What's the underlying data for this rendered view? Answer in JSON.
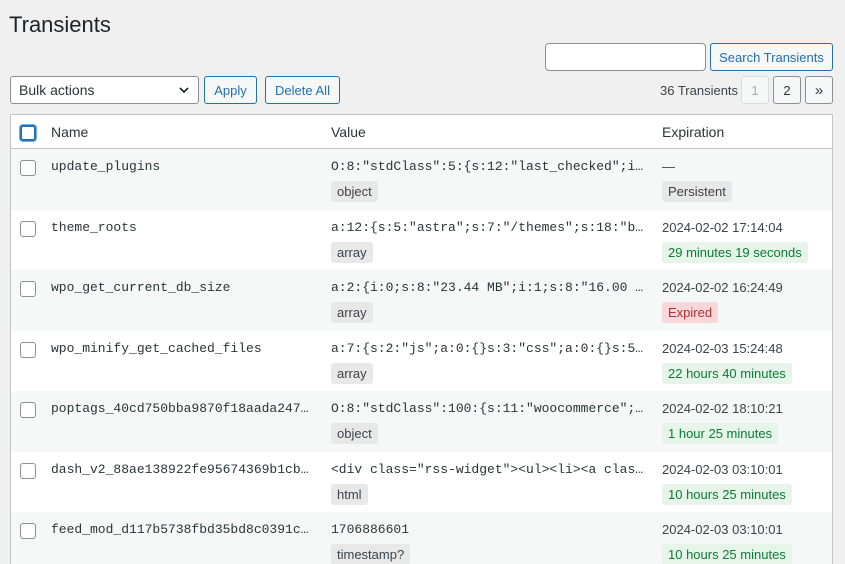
{
  "page": {
    "title": "Transients"
  },
  "search": {
    "placeholder": "",
    "button_label": "Search Transients"
  },
  "bulk": {
    "selected": "Bulk actions",
    "apply_label": "Apply",
    "delete_all_label": "Delete All"
  },
  "pagination": {
    "count_label": "36 Transients",
    "page1": "1",
    "page2": "2",
    "next": "»"
  },
  "table": {
    "headers": {
      "name": "Name",
      "value": "Value",
      "expiration": "Expiration"
    },
    "rows": [
      {
        "name": "update_plugins",
        "value": "O:8:\"stdClass\":5:{s:12:\"last_checked\";i:1…",
        "type": "object",
        "expiration": "—",
        "status": "Persistent",
        "status_kind": "persist"
      },
      {
        "name": "theme_roots",
        "value": "a:12:{s:5:\"astra\";s:7:\"/themes\";s:18:\"blo…",
        "type": "array",
        "expiration": "2024-02-02 17:14:04",
        "status": "29 minutes 19 seconds",
        "status_kind": "ok"
      },
      {
        "name": "wpo_get_current_db_size",
        "value": "a:2:{i:0;s:8:\"23.44 MB\";i:1;s:8:\"16.00 MB…",
        "type": "array",
        "expiration": "2024-02-02 16:24:49",
        "status": "Expired",
        "status_kind": "exp"
      },
      {
        "name": "wpo_minify_get_cached_files",
        "value": "a:7:{s:2:\"js\";a:0:{}s:3:\"css\";a:0:{}s:5:\"…",
        "type": "array",
        "expiration": "2024-02-03 15:24:48",
        "status": "22 hours 40 minutes",
        "status_kind": "ok"
      },
      {
        "name": "poptags_40cd750bba9870f18aada2478b…",
        "value": "O:8:\"stdClass\":100:{s:11:\"woocommerce\";a:…",
        "type": "object",
        "expiration": "2024-02-02 18:10:21",
        "status": "1 hour 25 minutes",
        "status_kind": "ok"
      },
      {
        "name": "dash_v2_88ae138922fe95674369b1cb3d…",
        "value": "<div class=\"rss-widget\"><ul><li><a class=…",
        "type": "html",
        "expiration": "2024-02-03 03:10:01",
        "status": "10 hours 25 minutes",
        "status_kind": "ok"
      },
      {
        "name": "feed_mod_d117b5738fbd35bd8c0391cda…",
        "value": "1706886601",
        "type": "timestamp?",
        "expiration": "2024-02-03 03:10:01",
        "status": "10 hours 25 minutes",
        "status_kind": "ok"
      }
    ]
  }
}
